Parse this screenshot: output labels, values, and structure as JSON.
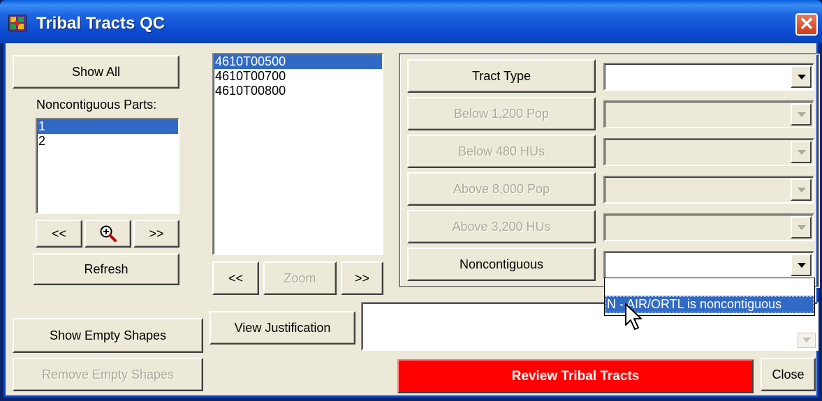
{
  "window": {
    "title": "Tribal Tracts QC",
    "close_glyph": "✕"
  },
  "left": {
    "show_all": "Show All",
    "noncontig_label": "Noncontiguous Parts:",
    "parts": [
      "1",
      "2"
    ],
    "selected_part": "1",
    "prev": "<<",
    "next": ">>",
    "refresh": "Refresh",
    "show_empty": "Show Empty Shapes",
    "remove_empty": "Remove Empty Shapes"
  },
  "middle": {
    "tracts": [
      "4610T00500",
      "4610T00700",
      "4610T00800"
    ],
    "selected_tract": "4610T00500",
    "prev": "<<",
    "zoom": "Zoom",
    "next": ">>",
    "view_justification": "View Justification"
  },
  "criteria": [
    {
      "label": "Tract Type",
      "value": "",
      "enabled": true
    },
    {
      "label": "Below 1,200 Pop",
      "value": "",
      "enabled": false
    },
    {
      "label": "Below 480 HUs",
      "value": "",
      "enabled": false
    },
    {
      "label": "Above 8,000 Pop",
      "value": "",
      "enabled": false
    },
    {
      "label": "Above 3,200 HUs",
      "value": "",
      "enabled": false
    },
    {
      "label": "Noncontiguous",
      "value": "",
      "enabled": true
    }
  ],
  "dropdown_open": {
    "options": [
      "",
      "N - AIR/ORTL is noncontiguous"
    ],
    "highlighted": "N - AIR/ORTL is noncontiguous"
  },
  "bottom": {
    "review": "Review Tribal Tracts",
    "close": "Close"
  },
  "colors": {
    "title_bar": "#0b4ad0",
    "review_button": "#ff0000",
    "selection": "#316ac5"
  },
  "icons": {
    "zoom_tool": "magnifier-plus-icon",
    "app": "tribal-pattern-icon"
  }
}
